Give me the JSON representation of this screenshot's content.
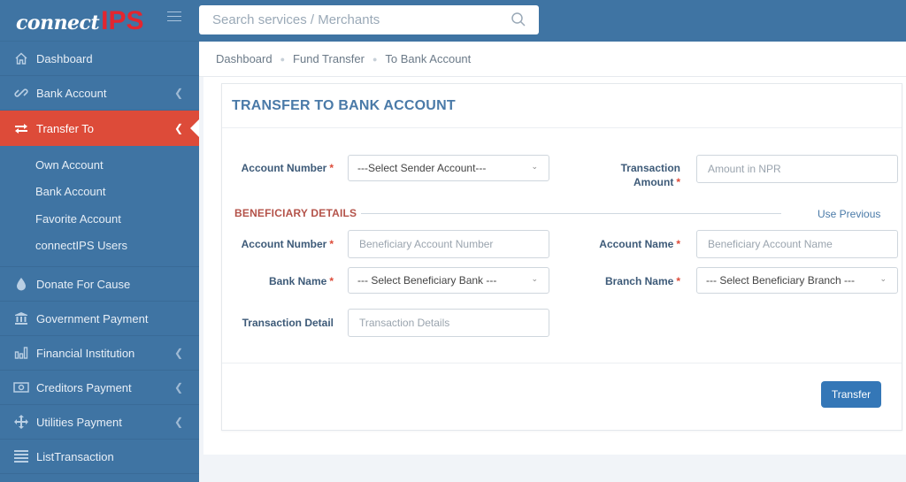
{
  "brand": {
    "logo_text_1": "connect",
    "logo_text_2": "IPS",
    "accent_color": "#dd4b39",
    "primary_color": "#3f74a3"
  },
  "search": {
    "placeholder": "Search services / Merchants",
    "value": ""
  },
  "sidebar": {
    "items": [
      {
        "label": "Dashboard",
        "icon": "home-icon",
        "has_chevron": false
      },
      {
        "label": "Bank Account",
        "icon": "link-icon",
        "has_chevron": true
      },
      {
        "label": "Transfer To",
        "icon": "exchange-icon",
        "has_chevron": true,
        "active": true,
        "children": [
          "Own Account",
          "Bank Account",
          "Favorite Account",
          "connectIPS Users"
        ]
      },
      {
        "label": "Donate For Cause",
        "icon": "drop-icon",
        "has_chevron": false
      },
      {
        "label": "Government Payment",
        "icon": "bank-building-icon",
        "has_chevron": false
      },
      {
        "label": "Financial Institution",
        "icon": "bar-chart-icon",
        "has_chevron": true
      },
      {
        "label": "Creditors Payment",
        "icon": "money-icon",
        "has_chevron": true
      },
      {
        "label": "Utilities Payment",
        "icon": "move-arrows-icon",
        "has_chevron": true
      },
      {
        "label": "ListTransaction",
        "icon": "list-icon",
        "has_chevron": false
      }
    ]
  },
  "breadcrumb": [
    "Dashboard",
    "Fund Transfer",
    "To Bank Account"
  ],
  "form": {
    "title": "TRANSFER TO BANK ACCOUNT",
    "sender_account": {
      "label": "Account Number",
      "required": "*",
      "selected": "---Select Sender Account---"
    },
    "amount": {
      "label_line1": "Transaction",
      "label_line2": "Amount",
      "required": "*",
      "placeholder": "Amount in NPR",
      "value": ""
    },
    "beneficiary_section": "BENEFICIARY DETAILS",
    "use_previous": "Use Previous",
    "beneficiary_account": {
      "label": "Account Number",
      "required": "*",
      "placeholder": "Beneficiary Account Number",
      "value": ""
    },
    "account_name": {
      "label": "Account Name",
      "required": "*",
      "placeholder": "Beneficiary Account Name",
      "value": ""
    },
    "bank_name": {
      "label": "Bank Name",
      "required": "*",
      "selected": "--- Select Beneficiary Bank ---"
    },
    "branch_name": {
      "label": "Branch Name",
      "required": "*",
      "selected": "--- Select Beneficiary Branch ---"
    },
    "transaction_detail": {
      "label": "Transaction Detail",
      "placeholder": "Transaction Details",
      "value": ""
    },
    "submit_label": "Transfer"
  }
}
